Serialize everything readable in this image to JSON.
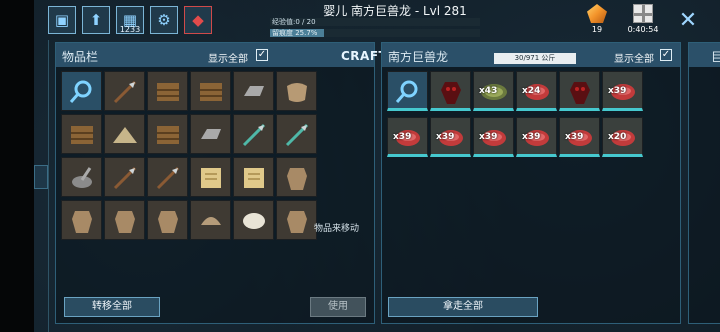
{
  "header": {
    "title": "婴儿 南方巨兽龙 - Lvl 281",
    "experience": "经验值:0 / 20",
    "imprint": "留痕度 25.7%",
    "imprint_fraction": 0.257,
    "tribe_count": "1233",
    "element_count": "19",
    "timer": "0:40:54"
  },
  "inventory": {
    "title": "物品栏",
    "show_all": "显示全部",
    "crafting_tab": "CRAFTING",
    "items": [
      {
        "name": "search-icon"
      },
      {
        "name": "spear-icon"
      },
      {
        "name": "storage-box-icon"
      },
      {
        "name": "crate-icon"
      },
      {
        "name": "metal-ingot-icon"
      },
      {
        "name": "hide-icon"
      },
      {
        "name": "wood-ramp-icon"
      },
      {
        "name": "thatch-roof-icon"
      },
      {
        "name": "thatch-foundation-icon"
      },
      {
        "name": "stone-slab-icon"
      },
      {
        "name": "metal-spear-icon"
      },
      {
        "name": "metal-pike-icon"
      },
      {
        "name": "mortar-pestle-icon"
      },
      {
        "name": "torch-icon"
      },
      {
        "name": "pick-icon"
      },
      {
        "name": "note-icon"
      },
      {
        "name": "map-icon"
      },
      {
        "name": "cloth-shirt-icon"
      },
      {
        "name": "cloth-gloves-icon"
      },
      {
        "name": "cloth-pants-icon"
      },
      {
        "name": "cloth-pants-alt-icon"
      },
      {
        "name": "cloth-hat-icon"
      },
      {
        "name": "bandage-icon"
      },
      {
        "name": "cloth-boots-icon"
      }
    ],
    "move_label": "物品来移动",
    "transfer_all": "转移全部",
    "use": "使用"
  },
  "dino": {
    "title": "南方巨兽龙",
    "weight": "30/971 公斤",
    "show_all": "显示全部",
    "items": [
      {
        "name": "search-icon",
        "qty": ""
      },
      {
        "name": "red-egg-icon",
        "qty": ""
      },
      {
        "name": "kibble-icon",
        "qty": "x43"
      },
      {
        "name": "raw-meat-icon",
        "qty": "x24"
      },
      {
        "name": "red-egg-icon",
        "qty": ""
      },
      {
        "name": "raw-meat-icon",
        "qty": "x39"
      },
      {
        "name": "raw-meat-icon",
        "qty": "x39"
      },
      {
        "name": "raw-meat-icon",
        "qty": "x39"
      },
      {
        "name": "raw-meat-icon",
        "qty": "x39"
      },
      {
        "name": "raw-meat-icon",
        "qty": "x39"
      },
      {
        "name": "raw-meat-icon",
        "qty": "x39"
      },
      {
        "name": "raw-meat-icon",
        "qty": "x20"
      }
    ],
    "take_all": "拿走全部"
  },
  "right_panel_fragment": "巨"
}
